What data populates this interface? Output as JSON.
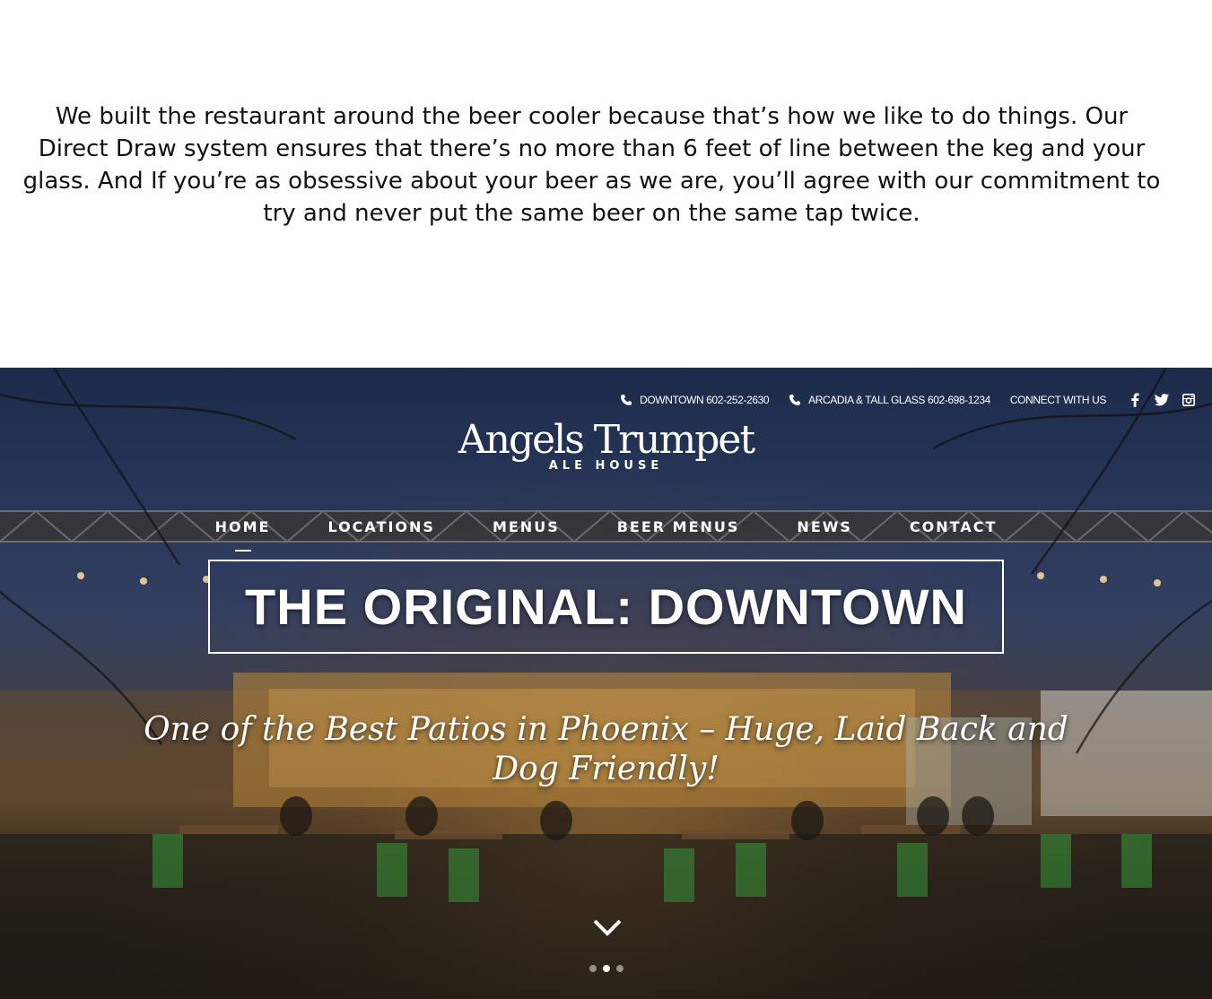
{
  "intro": {
    "text": "We built the restaurant around the beer cooler because that’s how we like to do things. Our Direct Draw system ensures that there’s no more than 6 feet of line between the keg and your glass. And If you’re as obsessive about your beer as we are, you’ll agree with our commitment to try and never put the same beer on the same tap twice."
  },
  "topbar": {
    "phone1": "DOWNTOWN 602-252-2630",
    "phone2": "ARCADIA & TALL GLASS 602-698-1234",
    "connect": "CONNECT WITH US",
    "icons": [
      "phone-icon",
      "facebook-icon",
      "twitter-icon",
      "instagram-icon"
    ]
  },
  "logo": {
    "name": "Angels Trumpet",
    "sub": "ALE HOUSE"
  },
  "nav": {
    "items": [
      "HOME",
      "LOCATIONS",
      "MENUS",
      "BEER MENUS",
      "NEWS",
      "CONTACT"
    ],
    "active": "HOME"
  },
  "hero": {
    "banner": "THE ORIGINAL: DOWNTOWN",
    "tagline": "One of the Best Patios in Phoenix – Huge, Laid Back and Dog Friendly!"
  },
  "slider": {
    "slide_count": 3,
    "active_index": 1
  }
}
